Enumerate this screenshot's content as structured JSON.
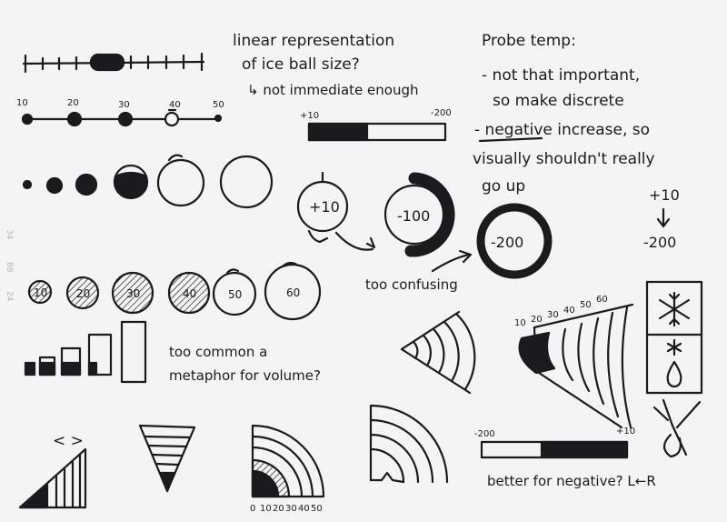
{
  "notes": {
    "linear_title_1": "linear representation",
    "linear_title_2": "of ice ball size?",
    "linear_sub": "↳ not immediate enough",
    "probe_1": "Probe temp:",
    "probe_2": "- not that important,",
    "probe_3": "so make discrete",
    "probe_4": "- negative increase, so",
    "probe_5": "visually shouldn't really",
    "probe_6": "go up",
    "too_confusing": "too confusing",
    "common_1": "too common a",
    "common_2": "metaphor for volume?",
    "better": "better for negative? L←R",
    "chevrons": "<   >"
  },
  "scale_labels": [
    "10",
    "20",
    "30",
    "40",
    "50"
  ],
  "bar_top": {
    "left": "+10",
    "right": "-200"
  },
  "bar_bottom": {
    "left": "-200",
    "right": "+10"
  },
  "rings": {
    "a": "+10",
    "b": "-100",
    "c": "-200"
  },
  "arrow_sequence": {
    "top": "+10",
    "arrow": "↓",
    "bottom": "-200"
  },
  "numbered_circles": [
    "10",
    "20",
    "30",
    "40",
    "50",
    "60"
  ],
  "fan_labels": [
    "10",
    "20",
    "30",
    "40",
    "50",
    "60"
  ],
  "quarter_labels": [
    "0",
    "10",
    "20",
    "30",
    "40",
    "50"
  ],
  "margin_marks": [
    "34",
    "88",
    "24"
  ],
  "colors": {
    "ink": "#1b1b1f",
    "paper": "#f4f4f6"
  }
}
